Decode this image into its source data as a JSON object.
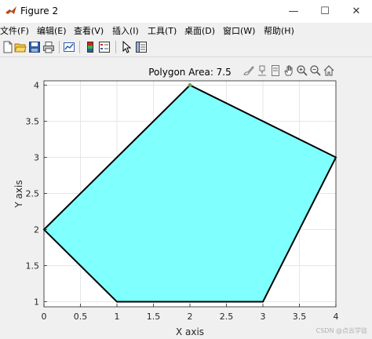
{
  "window": {
    "title": "Figure 2",
    "minimize_glyph": "—",
    "maximize_glyph": "☐",
    "close_glyph": "✕"
  },
  "menu": {
    "items": [
      "文件(F)",
      "编辑(E)",
      "查看(V)",
      "插入(I)",
      "工具(T)",
      "桌面(D)",
      "窗口(W)",
      "帮助(H)"
    ]
  },
  "toolbar": {
    "icons": [
      "new-figure-icon",
      "open-file-icon",
      "save-icon",
      "print-icon",
      "link-plot-icon",
      "colorbar-icon",
      "legend-icon",
      "edit-plot-icon",
      "property-inspector-icon"
    ]
  },
  "axes_toolbar": {
    "icons": [
      "brush-icon",
      "data-tips-icon",
      "restore-view-icon",
      "pan-icon",
      "zoom-in-icon",
      "zoom-out-icon",
      "home-icon"
    ]
  },
  "colors": {
    "fill": "#80ffff",
    "edge": "#000000",
    "vertex_marker": "#6aa06a",
    "grid": "#e6e6e6",
    "axes_bg": "#ffffff"
  },
  "chart_data": {
    "type": "area",
    "title": "Polygon Area: 7.5",
    "xlabel": "X axis",
    "ylabel": "Y axis",
    "xlim": [
      0,
      4
    ],
    "ylim": [
      0.93,
      4.06
    ],
    "grid": true,
    "xticks": [
      "0",
      "0.5",
      "1",
      "1.5",
      "2",
      "2.5",
      "3",
      "3.5",
      "4"
    ],
    "xtick_values": [
      0,
      0.5,
      1,
      1.5,
      2,
      2.5,
      3,
      3.5,
      4
    ],
    "yticks": [
      "1",
      "1.5",
      "2",
      "2.5",
      "3",
      "3.5",
      "4"
    ],
    "ytick_values": [
      1,
      1.5,
      2,
      2.5,
      3,
      3.5,
      4
    ],
    "polygon": {
      "x": [
        1,
        3,
        4,
        2,
        0
      ],
      "y": [
        1,
        1,
        3,
        4,
        2
      ]
    },
    "marked_vertex": {
      "x": 2,
      "y": 4
    }
  },
  "watermark": "CSDN @点云学徒"
}
